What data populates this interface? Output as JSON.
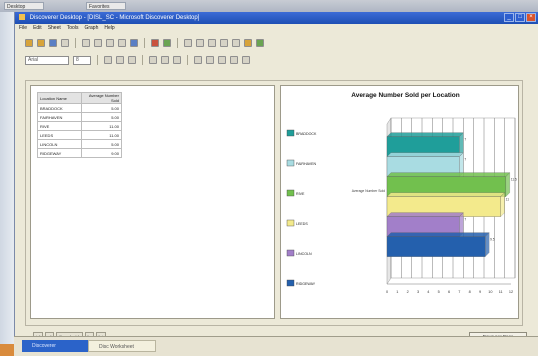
{
  "app": {
    "title": "Discoverer Desktop - [DISL_SC - Microsoft Discoverer Desktop]",
    "menu": [
      "File",
      "Edit",
      "Sheet",
      "Tools",
      "Graph",
      "Help"
    ]
  },
  "toolbar": {
    "font_value": "Arial",
    "size_value": "8"
  },
  "table": {
    "headers": [
      "Location Name",
      "Average Number Sold"
    ],
    "rows": [
      [
        "BRADDOCK",
        "5.00"
      ],
      [
        "FAIRHAVEN",
        "5.00"
      ],
      [
        "RIVE",
        "11.00"
      ],
      [
        "LEEDS",
        "11.00"
      ],
      [
        "LINCOLN",
        "5.00"
      ],
      [
        "RIDGEWAY",
        "9.00"
      ]
    ]
  },
  "chart_data": {
    "type": "bar",
    "orientation": "horizontal",
    "title": "Average Number Sold per Location",
    "category": "Average Number Sold",
    "series": [
      {
        "name": "BRADDOCK",
        "value": 7,
        "color": "#1f9e9a"
      },
      {
        "name": "FAIRHAVEN",
        "value": 7,
        "color": "#a9dce2"
      },
      {
        "name": "RIVE",
        "value": 11.5,
        "color": "#72c04e"
      },
      {
        "name": "LEEDS",
        "value": 11,
        "color": "#f3ea8c"
      },
      {
        "name": "LINCOLN",
        "value": 7,
        "color": "#a27fc9"
      },
      {
        "name": "RIDGEWAY",
        "value": 9.5,
        "color": "#2460ad"
      }
    ],
    "xlim": [
      0,
      12
    ],
    "ticks": [
      0,
      1,
      2,
      3,
      4,
      5,
      6,
      7,
      8,
      9,
      10,
      11,
      12
    ],
    "grid": true,
    "legend": "left"
  },
  "footer": {
    "page_label": "Page 1 of 1",
    "rows_button": "Rows per Page"
  },
  "taskbar": {
    "items": [
      "Discoverer",
      "Disc Worksheet"
    ]
  },
  "desktop": {
    "tabs": [
      "Desktop",
      "Favorites"
    ]
  }
}
